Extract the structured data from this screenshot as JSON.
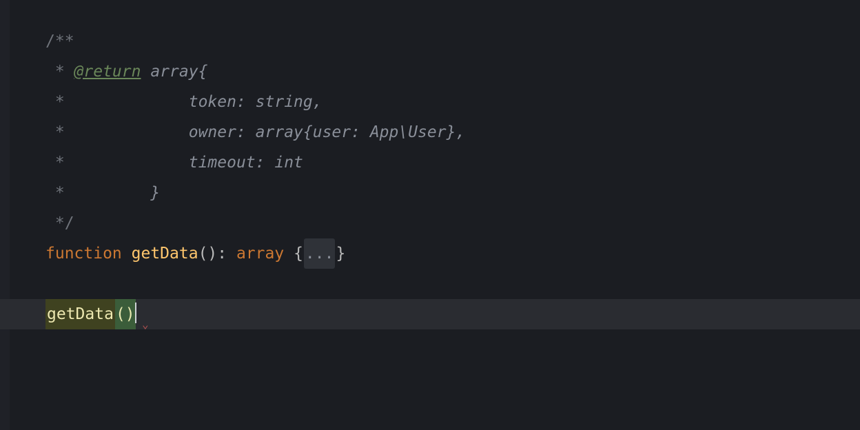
{
  "doc": {
    "open": "/**",
    "l2_star": " * ",
    "l2_tag": "@return",
    "l2_rest": " array{",
    "l3_star": " *             ",
    "l3_rest": "token: string,",
    "l4_star": " *             ",
    "l4_rest": "owner: array{user: App\\User},",
    "l5_star": " *             ",
    "l5_rest": "timeout: int",
    "l6_star": " *         ",
    "l6_rest": "}",
    "close": " */"
  },
  "func": {
    "kw": "function",
    "sp1": " ",
    "name": "getData",
    "after_name": "(): ",
    "ret": "array",
    "brace_open": " {",
    "fold": "...",
    "brace_close": "}"
  },
  "call": {
    "name": "getData",
    "parens": "()"
  }
}
